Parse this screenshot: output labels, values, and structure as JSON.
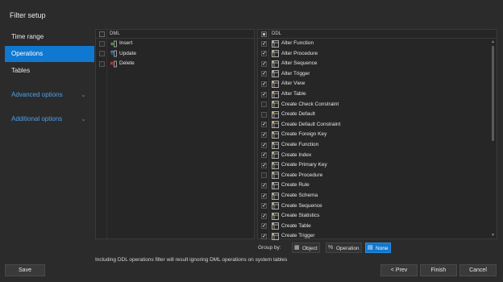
{
  "window": {
    "title": "Filter setup"
  },
  "sidebar": {
    "items": [
      {
        "label": "Time range",
        "active": false
      },
      {
        "label": "Operations",
        "active": true
      },
      {
        "label": "Tables",
        "active": false
      }
    ],
    "sections": [
      {
        "label": "Advanced options",
        "icon": "chevron-down-icon"
      },
      {
        "label": "Additional options",
        "icon": "chevron-down-icon"
      }
    ]
  },
  "dml": {
    "header": "DML",
    "header_checked": false,
    "items": [
      {
        "label": "Insert",
        "checked": false,
        "icon": "insert-icon",
        "color": "#4fb04f"
      },
      {
        "label": "Update",
        "checked": false,
        "icon": "update-icon",
        "color": "#3a8ee6"
      },
      {
        "label": "Delete",
        "checked": false,
        "icon": "delete-icon",
        "color": "#e04040"
      }
    ]
  },
  "ddl": {
    "header": "DDL",
    "header_state": "partial",
    "items": [
      {
        "label": "Alter Function",
        "checked": true,
        "icon": "alter-function-icon"
      },
      {
        "label": "Alter Procedure",
        "checked": true,
        "icon": "alter-procedure-icon"
      },
      {
        "label": "Alter Sequence",
        "checked": true,
        "icon": "alter-sequence-icon"
      },
      {
        "label": "Alter Trigger",
        "checked": true,
        "icon": "alter-trigger-icon"
      },
      {
        "label": "Alter View",
        "checked": true,
        "icon": "alter-view-icon"
      },
      {
        "label": "Alter Table",
        "checked": true,
        "icon": "alter-table-icon"
      },
      {
        "label": "Create Check Constraint",
        "checked": false,
        "icon": "check-constraint-icon"
      },
      {
        "label": "Create Default",
        "checked": false,
        "icon": "default-icon"
      },
      {
        "label": "Create Default Constraint",
        "checked": true,
        "icon": "default-constraint-icon"
      },
      {
        "label": "Create Foreign Key",
        "checked": true,
        "icon": "foreign-key-icon"
      },
      {
        "label": "Create Function",
        "checked": true,
        "icon": "function-icon"
      },
      {
        "label": "Create Index",
        "checked": true,
        "icon": "index-icon"
      },
      {
        "label": "Create Primary Key",
        "checked": true,
        "icon": "primary-key-icon"
      },
      {
        "label": "Create Procedure",
        "checked": false,
        "icon": "procedure-icon"
      },
      {
        "label": "Create Rule",
        "checked": true,
        "icon": "rule-icon"
      },
      {
        "label": "Create Schema",
        "checked": true,
        "icon": "schema-icon"
      },
      {
        "label": "Create Sequence",
        "checked": true,
        "icon": "sequence-icon"
      },
      {
        "label": "Create Statistics",
        "checked": true,
        "icon": "statistics-icon"
      },
      {
        "label": "Create Table",
        "checked": true,
        "icon": "table-icon"
      },
      {
        "label": "Create Trigger",
        "checked": true,
        "icon": "trigger-icon"
      }
    ]
  },
  "group_by": {
    "label": "Group by:",
    "options": [
      {
        "label": "Object",
        "icon": "object-icon",
        "active": false
      },
      {
        "label": "Operation",
        "icon": "operation-icon",
        "active": false
      },
      {
        "label": "None",
        "icon": "none-icon",
        "active": true
      }
    ]
  },
  "info_text": "Including DDL operations filter will result ignoring DML operations on system tables",
  "buttons": {
    "save": "Save",
    "prev": "< Prev",
    "finish": "Finish",
    "cancel": "Cancel"
  },
  "colors": {
    "accent": "#0f78d0",
    "link": "#4ea1e8",
    "background": "#2b2b2b"
  }
}
